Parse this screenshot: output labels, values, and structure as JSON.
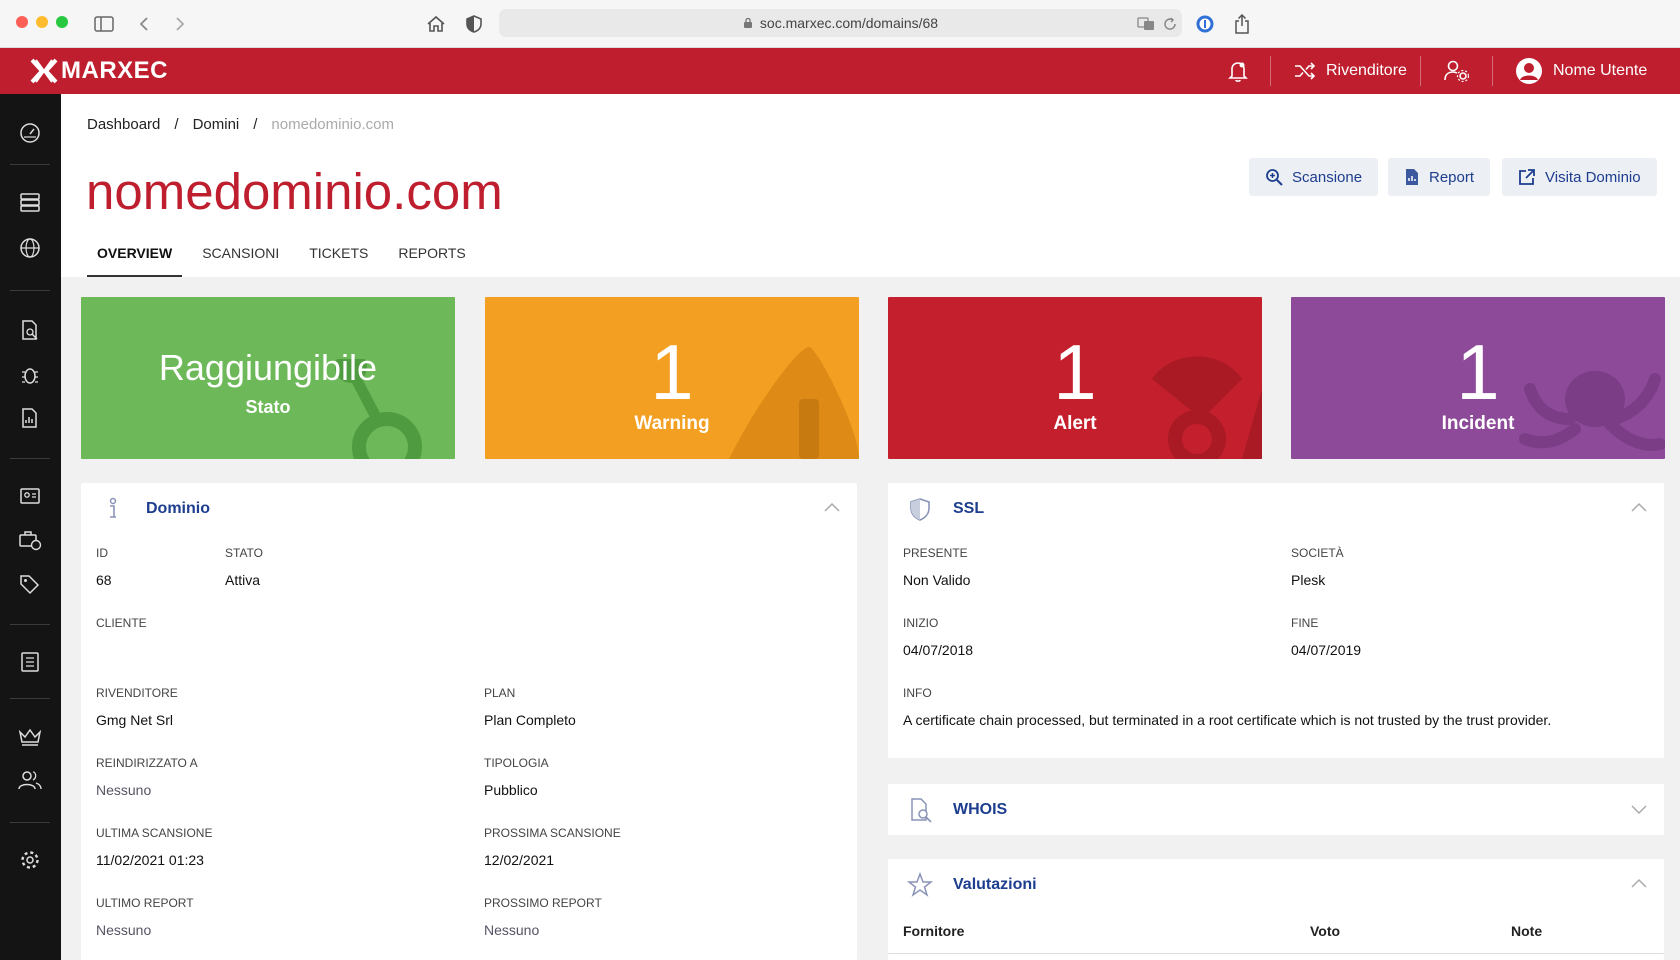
{
  "browser": {
    "url": "soc.marxec.com/domains/68"
  },
  "topbar": {
    "logo": "MARXEC",
    "reseller_label": "Rivenditore",
    "user_name": "Nome Utente"
  },
  "breadcrumb": {
    "items": [
      "Dashboard",
      "Domini"
    ],
    "current": "nomedominio.com",
    "sep": "/"
  },
  "page": {
    "title": "nomedominio.com"
  },
  "actions": {
    "scan": "Scansione",
    "report": "Report",
    "visit": "Visita Dominio"
  },
  "tabs": [
    "OVERVIEW",
    "SCANSIONI",
    "TICKETS",
    "REPORTS"
  ],
  "cards": {
    "status": {
      "value": "Raggiungibile",
      "label": "Stato",
      "color": "#6db858"
    },
    "warning": {
      "value": "1",
      "label": "Warning",
      "color": "#f39f21"
    },
    "alert": {
      "value": "1",
      "label": "Alert",
      "color": "#c41f2c"
    },
    "incident": {
      "value": "1",
      "label": "Incident",
      "color": "#8d4a99"
    }
  },
  "dominio": {
    "title": "Dominio",
    "fields": {
      "id": {
        "k": "ID",
        "v": "68"
      },
      "stato": {
        "k": "STATO",
        "v": "Attiva"
      },
      "cliente": {
        "k": "CLIENTE",
        "v": ""
      },
      "rivenditore": {
        "k": "RIVENDITORE",
        "v": "Gmg Net Srl"
      },
      "plan": {
        "k": "PLAN",
        "v": "Plan Completo"
      },
      "reindirizzato": {
        "k": "REINDIRIZZATO A",
        "v": "Nessuno"
      },
      "tipologia": {
        "k": "TIPOLOGIA",
        "v": "Pubblico"
      },
      "ultima": {
        "k": "ULTIMA SCANSIONE",
        "v": "11/02/2021 01:23"
      },
      "prossima": {
        "k": "PROSSIMA SCANSIONE",
        "v": "12/02/2021"
      },
      "ultimo_report": {
        "k": "ULTIMO REPORT",
        "v": "Nessuno"
      },
      "prossimo_report": {
        "k": "PROSSIMO REPORT",
        "v": "Nessuno"
      }
    }
  },
  "ssl": {
    "title": "SSL",
    "fields": {
      "presente": {
        "k": "PRESENTE",
        "v": "Non Valido"
      },
      "societa": {
        "k": "SOCIETÀ",
        "v": "Plesk"
      },
      "inizio": {
        "k": "INIZIO",
        "v": "04/07/2018"
      },
      "fine": {
        "k": "FINE",
        "v": "04/07/2019"
      },
      "info": {
        "k": "INFO",
        "v": "A certificate chain processed, but terminated in a root certificate which is not trusted by the trust provider."
      }
    }
  },
  "whois": {
    "title": "WHOIS"
  },
  "valutazioni": {
    "title": "Valutazioni",
    "columns": [
      "Fornitore",
      "Voto",
      "Note"
    ]
  }
}
